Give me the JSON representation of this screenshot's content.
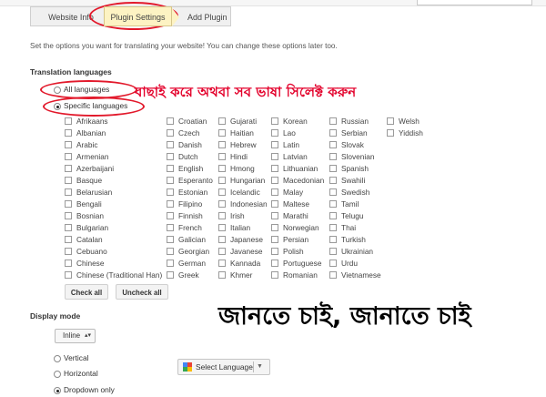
{
  "tabs": [
    {
      "label": "Website Info"
    },
    {
      "label": "Plugin Settings"
    },
    {
      "label": "Add Plugin"
    }
  ],
  "intro_text": "Set the options you want for translating your website! You can change these options later too.",
  "translation_languages": {
    "heading": "Translation languages",
    "option_all": "All languages",
    "option_specific": "Specific languages",
    "selected": "Specific languages"
  },
  "annotation_top": "বাছাই করে অথবা সব ভাষা  সিলেক্ট করুন",
  "annotation_bottom": "জানতে চাই, জানাতে চাই",
  "languages": [
    [
      "Afrikaans",
      "Albanian",
      "Arabic",
      "Armenian",
      "Azerbaijani",
      "Basque",
      "Belarusian",
      "Bengali",
      "Bosnian",
      "Bulgarian",
      "Catalan",
      "Cebuano",
      "Chinese",
      "Chinese (Traditional Han)"
    ],
    [
      "Croatian",
      "Czech",
      "Danish",
      "Dutch",
      "English",
      "Esperanto",
      "Estonian",
      "Filipino",
      "Finnish",
      "French",
      "Galician",
      "Georgian",
      "German",
      "Greek"
    ],
    [
      "Gujarati",
      "Haitian",
      "Hebrew",
      "Hindi",
      "Hmong",
      "Hungarian",
      "Icelandic",
      "Indonesian",
      "Irish",
      "Italian",
      "Japanese",
      "Javanese",
      "Kannada",
      "Khmer"
    ],
    [
      "Korean",
      "Lao",
      "Latin",
      "Latvian",
      "Lithuanian",
      "Macedonian",
      "Malay",
      "Maltese",
      "Marathi",
      "Norwegian",
      "Persian",
      "Polish",
      "Portuguese",
      "Romanian"
    ],
    [
      "Russian",
      "Serbian",
      "Slovak",
      "Slovenian",
      "Spanish",
      "Swahili",
      "Swedish",
      "Tamil",
      "Telugu",
      "Thai",
      "Turkish",
      "Ukrainian",
      "Urdu",
      "Vietnamese"
    ],
    [
      "Welsh",
      "Yiddish"
    ]
  ],
  "buttons": {
    "check_all": "Check all",
    "uncheck_all": "Uncheck all"
  },
  "display_mode": {
    "heading": "Display mode",
    "select_value": "Inline",
    "options": [
      "Vertical",
      "Horizontal",
      "Dropdown only"
    ],
    "selected": "Dropdown only"
  },
  "widget_preview": {
    "label": "Select Language"
  },
  "colors": {
    "annotation_red": "#e3002b",
    "active_tab": "#fdf3c3"
  }
}
